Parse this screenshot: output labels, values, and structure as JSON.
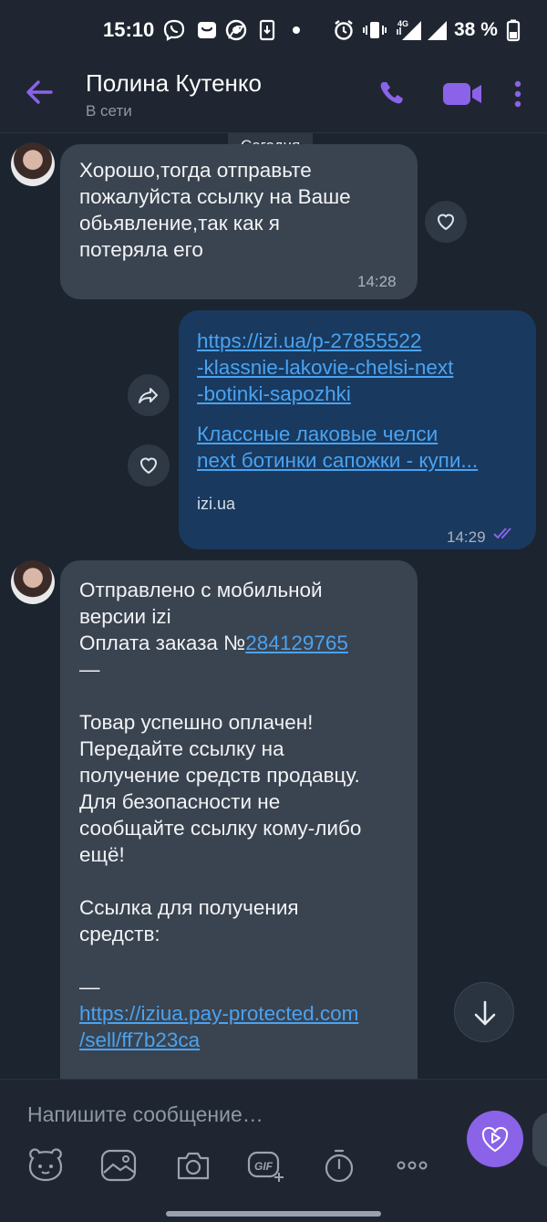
{
  "status_bar": {
    "time": "15:10",
    "network": "4G",
    "battery": "38 %"
  },
  "header": {
    "contact_name": "Полина Кутенко",
    "presence": "В сети"
  },
  "chat": {
    "date_separator": "Сегодня",
    "messages": [
      {
        "direction": "incoming",
        "lines": [
          "Хорошо,тогда отправьте",
          "пожалуйста ссылку на Ваше",
          "обьявление,так как я",
          "потеряла его"
        ],
        "time": "14:28"
      },
      {
        "direction": "outgoing",
        "link_lines": [
          "https://izi.ua/p-27855522",
          "-klassnie-lakovie-chelsi-next",
          "-botinki-sapozhki"
        ],
        "preview_title_lines": [
          "Классные лаковые челси",
          "next ботинки сапожки - купи..."
        ],
        "preview_domain": "izi.ua",
        "time": "14:29"
      },
      {
        "direction": "incoming",
        "line1": "Отправлено с мобильной",
        "line2": "версии izi",
        "order_prefix": "Оплата заказа №",
        "order_number": "284129765",
        "dash1": "—",
        "body_lines": [
          "Товар успешно оплачен!",
          "Передайте ссылку на",
          "получение средств продавцу.",
          "Для безопасности не",
          "сообщайте ссылку кому-либо",
          "ещё!"
        ],
        "link_label_lines": [
          "Ссылка для получения",
          "средств:"
        ],
        "dash2": "—",
        "pay_link_lines": [
          "https://iziua.pay-protected.com",
          "/sell/ff7b23ca"
        ]
      }
    ]
  },
  "composer": {
    "placeholder": "Напишите сообщение…",
    "gif_label": "GIF"
  },
  "colors": {
    "accent": "#8a63e8",
    "link": "#4aa3f0",
    "incoming_bubble": "#3a4350",
    "outgoing_bubble": "#19395f"
  }
}
